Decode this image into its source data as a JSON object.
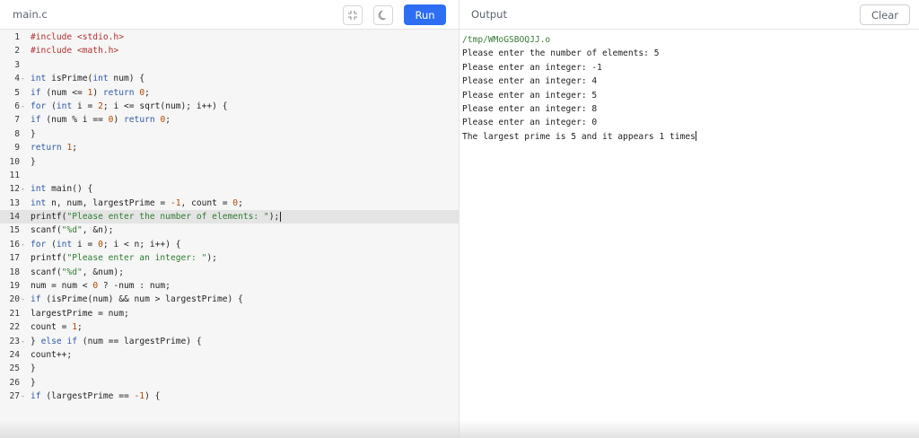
{
  "header": {
    "editor_tab": "main.c",
    "run_label": "Run",
    "output_title": "Output",
    "clear_label": "Clear",
    "icons": {
      "fullscreen": "exit-fullscreen-icon",
      "theme": "moon-icon"
    },
    "accent_color": "#2d6ef2"
  },
  "editor": {
    "active_line": 14,
    "lines": [
      {
        "n": "1",
        "fold": "",
        "code": [
          [
            "inc",
            "#include "
          ],
          [
            "inc",
            "<stdio.h>"
          ]
        ]
      },
      {
        "n": "2",
        "fold": "",
        "code": [
          [
            "inc",
            "#include "
          ],
          [
            "inc",
            "<math.h>"
          ]
        ]
      },
      {
        "n": "3",
        "fold": "",
        "code": []
      },
      {
        "n": "4",
        "fold": "-",
        "code": [
          [
            "kw",
            "int"
          ],
          [
            "op",
            " isPrime("
          ],
          [
            "kw",
            "int"
          ],
          [
            "op",
            " num) {"
          ]
        ]
      },
      {
        "n": "5",
        "fold": "",
        "code": [
          [
            "kw",
            "if"
          ],
          [
            "op",
            " (num <= "
          ],
          [
            "num",
            "1"
          ],
          [
            "op",
            ") "
          ],
          [
            "kw",
            "return"
          ],
          [
            "op",
            " "
          ],
          [
            "num",
            "0"
          ],
          [
            "op",
            ";"
          ]
        ]
      },
      {
        "n": "6",
        "fold": "-",
        "code": [
          [
            "kw",
            "for"
          ],
          [
            "op",
            " ("
          ],
          [
            "kw",
            "int"
          ],
          [
            "op",
            " i = "
          ],
          [
            "num",
            "2"
          ],
          [
            "op",
            "; i <= sqrt(num); i++) {"
          ]
        ]
      },
      {
        "n": "7",
        "fold": "",
        "code": [
          [
            "kw",
            "if"
          ],
          [
            "op",
            " (num % i == "
          ],
          [
            "num",
            "0"
          ],
          [
            "op",
            ") "
          ],
          [
            "kw",
            "return"
          ],
          [
            "op",
            " "
          ],
          [
            "num",
            "0"
          ],
          [
            "op",
            ";"
          ]
        ]
      },
      {
        "n": "8",
        "fold": "",
        "code": [
          [
            "op",
            "}"
          ]
        ]
      },
      {
        "n": "9",
        "fold": "",
        "code": [
          [
            "kw",
            "return"
          ],
          [
            "op",
            " "
          ],
          [
            "num",
            "1"
          ],
          [
            "op",
            ";"
          ]
        ]
      },
      {
        "n": "10",
        "fold": "",
        "code": [
          [
            "op",
            "}"
          ]
        ]
      },
      {
        "n": "11",
        "fold": "",
        "code": []
      },
      {
        "n": "12",
        "fold": "-",
        "code": [
          [
            "kw",
            "int"
          ],
          [
            "op",
            " main() {"
          ]
        ]
      },
      {
        "n": "13",
        "fold": "",
        "code": [
          [
            "kw",
            "int"
          ],
          [
            "op",
            " n, num, largestPrime = "
          ],
          [
            "num",
            "-1"
          ],
          [
            "op",
            ", count = "
          ],
          [
            "num",
            "0"
          ],
          [
            "op",
            ";"
          ]
        ]
      },
      {
        "n": "14",
        "fold": "",
        "code": [
          [
            "op",
            "printf("
          ],
          [
            "str",
            "\"Please enter the number of elements: \""
          ],
          [
            "op",
            ");"
          ]
        ]
      },
      {
        "n": "15",
        "fold": "",
        "code": [
          [
            "op",
            "scanf("
          ],
          [
            "str",
            "\"%d\""
          ],
          [
            "op",
            ", &n);"
          ]
        ]
      },
      {
        "n": "16",
        "fold": "-",
        "code": [
          [
            "kw",
            "for"
          ],
          [
            "op",
            " ("
          ],
          [
            "kw",
            "int"
          ],
          [
            "op",
            " i = "
          ],
          [
            "num",
            "0"
          ],
          [
            "op",
            "; i < n; i++) {"
          ]
        ]
      },
      {
        "n": "17",
        "fold": "",
        "code": [
          [
            "op",
            "printf("
          ],
          [
            "str",
            "\"Please enter an integer: \""
          ],
          [
            "op",
            ");"
          ]
        ]
      },
      {
        "n": "18",
        "fold": "",
        "code": [
          [
            "op",
            "scanf("
          ],
          [
            "str",
            "\"%d\""
          ],
          [
            "op",
            ", &num);"
          ]
        ]
      },
      {
        "n": "19",
        "fold": "",
        "code": [
          [
            "op",
            "num = num < "
          ],
          [
            "num",
            "0"
          ],
          [
            "op",
            " ? -num : num;"
          ]
        ]
      },
      {
        "n": "20",
        "fold": "-",
        "code": [
          [
            "kw",
            "if"
          ],
          [
            "op",
            " (isPrime(num) && num > largestPrime) {"
          ]
        ]
      },
      {
        "n": "21",
        "fold": "",
        "code": [
          [
            "op",
            "largestPrime = num;"
          ]
        ]
      },
      {
        "n": "22",
        "fold": "",
        "code": [
          [
            "op",
            "count = "
          ],
          [
            "num",
            "1"
          ],
          [
            "op",
            ";"
          ]
        ]
      },
      {
        "n": "23",
        "fold": "-",
        "code": [
          [
            "op",
            "} "
          ],
          [
            "kw",
            "else"
          ],
          [
            "op",
            " "
          ],
          [
            "kw",
            "if"
          ],
          [
            "op",
            " (num == largestPrime) {"
          ]
        ]
      },
      {
        "n": "24",
        "fold": "",
        "code": [
          [
            "op",
            "count++;"
          ]
        ]
      },
      {
        "n": "25",
        "fold": "",
        "code": [
          [
            "op",
            "}"
          ]
        ]
      },
      {
        "n": "26",
        "fold": "",
        "code": [
          [
            "op",
            "}"
          ]
        ]
      },
      {
        "n": "27",
        "fold": "-",
        "code": [
          [
            "kw",
            "if"
          ],
          [
            "op",
            " (largestPrime == "
          ],
          [
            "num",
            "-1"
          ],
          [
            "op",
            ") {"
          ]
        ]
      }
    ]
  },
  "output": {
    "path": "/tmp/WMoGSBOQJJ.o",
    "lines": [
      "Please enter the number of elements: 5",
      "Please enter an integer: -1",
      "Please enter an integer: 4",
      "Please enter an integer: 5",
      "Please enter an integer: 8",
      "Please enter an integer: 0",
      "The largest prime is 5 and it appears 1 times"
    ]
  }
}
